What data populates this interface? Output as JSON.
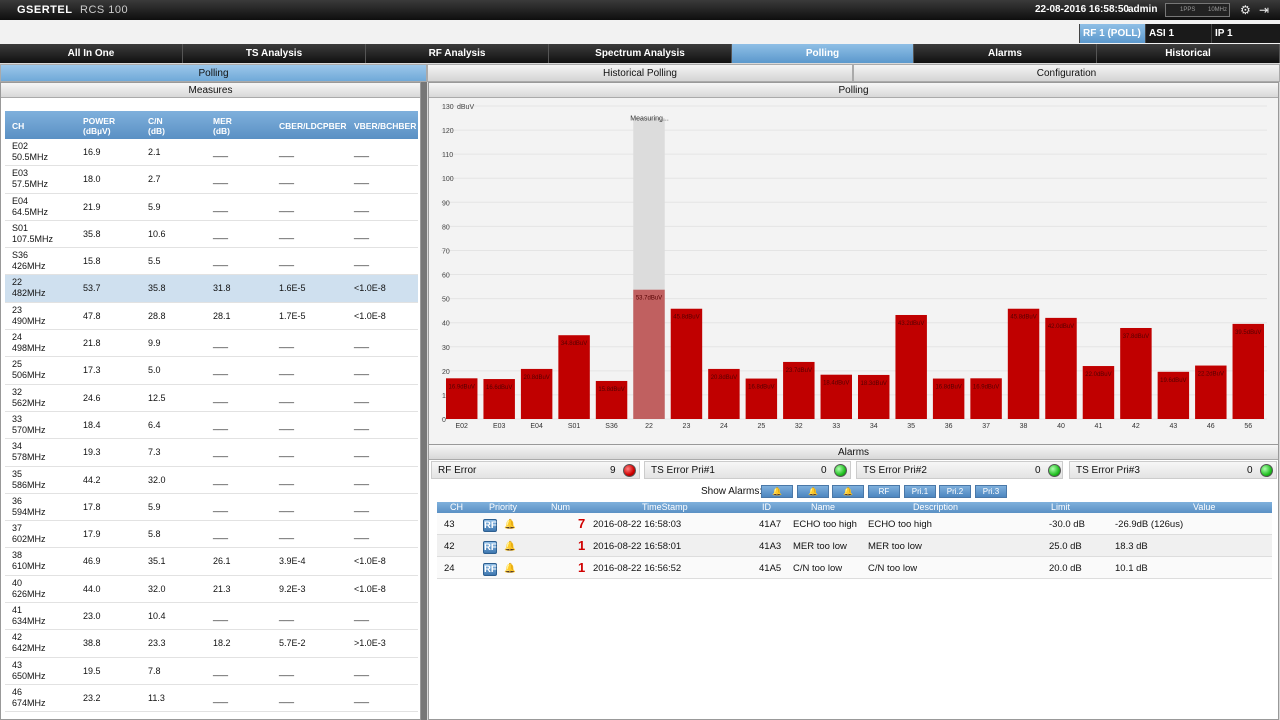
{
  "topbar": {
    "brand": "GSERTEL",
    "model": "RCS 100",
    "datetime": "22-08-2016 16:58:50",
    "user": "admin",
    "meter_a": "1PPS",
    "meter_b": "10MHz"
  },
  "sources": [
    "RF 1 (POLL)",
    "ASI 1",
    "IP 1"
  ],
  "nav": [
    "All In One",
    "TS Analysis",
    "RF Analysis",
    "Spectrum Analysis",
    "Polling",
    "Alarms",
    "Historical"
  ],
  "subtabs": [
    "Polling",
    "Historical Polling",
    "Configuration"
  ],
  "measures": {
    "title": "Measures",
    "headers": {
      "ch": "CH",
      "power": "POWER (dBµV)",
      "cn": "C/N (dB)",
      "mer": "MER (dB)",
      "cber": "CBER/LDCPBER",
      "vber": "VBER/BCHBER"
    },
    "rows": [
      {
        "ch": "E02",
        "freq": "50.5MHz",
        "power": "16.9",
        "cn": "2.1",
        "mer": "___",
        "cber": "___",
        "vber": "___"
      },
      {
        "ch": "E03",
        "freq": "57.5MHz",
        "power": "18.0",
        "cn": "2.7",
        "mer": "___",
        "cber": "___",
        "vber": "___"
      },
      {
        "ch": "E04",
        "freq": "64.5MHz",
        "power": "21.9",
        "cn": "5.9",
        "mer": "___",
        "cber": "___",
        "vber": "___"
      },
      {
        "ch": "S01",
        "freq": "107.5MHz",
        "power": "35.8",
        "cn": "10.6",
        "mer": "___",
        "cber": "___",
        "vber": "___"
      },
      {
        "ch": "S36",
        "freq": "426MHz",
        "power": "15.8",
        "cn": "5.5",
        "mer": "___",
        "cber": "___",
        "vber": "___"
      },
      {
        "ch": "22",
        "freq": "482MHz",
        "power": "53.7",
        "cn": "35.8",
        "mer": "31.8",
        "cber": "1.6E-5",
        "vber": "<1.0E-8"
      },
      {
        "ch": "23",
        "freq": "490MHz",
        "power": "47.8",
        "cn": "28.8",
        "mer": "28.1",
        "cber": "1.7E-5",
        "vber": "<1.0E-8"
      },
      {
        "ch": "24",
        "freq": "498MHz",
        "power": "21.8",
        "cn": "9.9",
        "mer": "___",
        "cber": "___",
        "vber": "___"
      },
      {
        "ch": "25",
        "freq": "506MHz",
        "power": "17.3",
        "cn": "5.0",
        "mer": "___",
        "cber": "___",
        "vber": "___"
      },
      {
        "ch": "32",
        "freq": "562MHz",
        "power": "24.6",
        "cn": "12.5",
        "mer": "___",
        "cber": "___",
        "vber": "___"
      },
      {
        "ch": "33",
        "freq": "570MHz",
        "power": "18.4",
        "cn": "6.4",
        "mer": "___",
        "cber": "___",
        "vber": "___"
      },
      {
        "ch": "34",
        "freq": "578MHz",
        "power": "19.3",
        "cn": "7.3",
        "mer": "___",
        "cber": "___",
        "vber": "___"
      },
      {
        "ch": "35",
        "freq": "586MHz",
        "power": "44.2",
        "cn": "32.0",
        "mer": "___",
        "cber": "___",
        "vber": "___"
      },
      {
        "ch": "36",
        "freq": "594MHz",
        "power": "17.8",
        "cn": "5.9",
        "mer": "___",
        "cber": "___",
        "vber": "___"
      },
      {
        "ch": "37",
        "freq": "602MHz",
        "power": "17.9",
        "cn": "5.8",
        "mer": "___",
        "cber": "___",
        "vber": "___"
      },
      {
        "ch": "38",
        "freq": "610MHz",
        "power": "46.9",
        "cn": "35.1",
        "mer": "26.1",
        "cber": "3.9E-4",
        "vber": "<1.0E-8"
      },
      {
        "ch": "40",
        "freq": "626MHz",
        "power": "44.0",
        "cn": "32.0",
        "mer": "21.3",
        "cber": "9.2E-3",
        "vber": "<1.0E-8"
      },
      {
        "ch": "41",
        "freq": "634MHz",
        "power": "23.0",
        "cn": "10.4",
        "mer": "___",
        "cber": "___",
        "vber": "___"
      },
      {
        "ch": "42",
        "freq": "642MHz",
        "power": "38.8",
        "cn": "23.3",
        "mer": "18.2",
        "cber": "5.7E-2",
        "vber": ">1.0E-3"
      },
      {
        "ch": "43",
        "freq": "650MHz",
        "power": "19.5",
        "cn": "7.8",
        "mer": "___",
        "cber": "___",
        "vber": "___"
      },
      {
        "ch": "46",
        "freq": "674MHz",
        "power": "23.2",
        "cn": "11.3",
        "mer": "___",
        "cber": "___",
        "vber": "___"
      }
    ]
  },
  "polling": {
    "title": "Polling",
    "measuring": "Measuring..."
  },
  "chart_data": {
    "type": "bar",
    "ylabel": "dBuV",
    "ylim": [
      0,
      130
    ],
    "yticks": [
      0,
      10,
      20,
      30,
      40,
      50,
      60,
      70,
      80,
      90,
      100,
      110,
      120,
      130
    ],
    "categories": [
      "E02",
      "E03",
      "E04",
      "S01",
      "S36",
      "22",
      "23",
      "24",
      "25",
      "32",
      "33",
      "34",
      "35",
      "36",
      "37",
      "38",
      "40",
      "41",
      "42",
      "43",
      "46",
      "56"
    ],
    "values": [
      16.9,
      16.6,
      20.8,
      34.8,
      15.8,
      53.7,
      45.8,
      20.8,
      16.8,
      23.7,
      18.4,
      18.3,
      43.2,
      16.8,
      16.9,
      45.8,
      42.0,
      22.0,
      37.8,
      19.6,
      22.2,
      39.5
    ],
    "labels": [
      "16.9dBuV",
      "16.6dBuV",
      "20.8dBuV",
      "34.8dBuV",
      "15.8dBuV",
      "53.7dBuV",
      "45.8dBuV",
      "20.8dBuV",
      "16.8dBuV",
      "23.7dBuV",
      "18.4dBuV",
      "18.3dBuV",
      "43.2dBuV",
      "16.8dBuV",
      "16.9dBuV",
      "45.8dBuV",
      "42.0dBuV",
      "22.0dBuV",
      "37.8dBuV",
      "19.6dBuV",
      "22.2dBuV",
      "39.5dBuV"
    ],
    "highlight_index": 5,
    "bar_color": "#c00000",
    "highlight_color": "#c06060"
  },
  "alarms": {
    "title": "Alarms",
    "summary": [
      {
        "label": "RF Error",
        "count": "9",
        "status": "red"
      },
      {
        "label": "TS Error Pri#1",
        "count": "0",
        "status": "green"
      },
      {
        "label": "TS Error Pri#2",
        "count": "0",
        "status": "green"
      },
      {
        "label": "TS Error Pri#3",
        "count": "0",
        "status": "green"
      }
    ],
    "show_label": "Show Alarms:",
    "filters": [
      "RF",
      "Pri.1",
      "Pri.2",
      "Pri.3"
    ],
    "headers": {
      "ch": "CH",
      "priority": "Priority",
      "num": "Num",
      "timestamp": "TimeStamp",
      "id": "ID",
      "name": "Name",
      "description": "Description",
      "limit": "Limit",
      "value": "Value"
    },
    "rows": [
      {
        "ch": "43",
        "badge": "RF",
        "num": "7",
        "timestamp": "2016-08-22 16:58:03",
        "id": "41A7",
        "name": "ECHO too high",
        "description": "ECHO too high",
        "limit": "-30.0 dB",
        "value": "-26.9dB (126us)"
      },
      {
        "ch": "42",
        "badge": "RF",
        "num": "1",
        "timestamp": "2016-08-22 16:58:01",
        "id": "41A3",
        "name": "MER too low",
        "description": "MER too low",
        "limit": "25.0 dB",
        "value": "18.3 dB"
      },
      {
        "ch": "24",
        "badge": "RF",
        "num": "1",
        "timestamp": "2016-08-22 16:56:52",
        "id": "41A5",
        "name": "C/N too low",
        "description": "C/N too low",
        "limit": "20.0 dB",
        "value": "10.1 dB"
      }
    ]
  }
}
